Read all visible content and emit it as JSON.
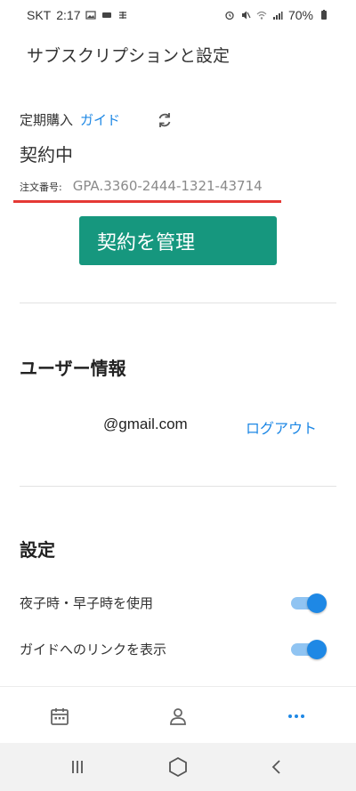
{
  "status_bar": {
    "carrier": "SKT",
    "time": "2:17",
    "battery": "70%"
  },
  "header": {
    "title": "サブスクリプションと設定"
  },
  "subscription": {
    "label": "定期購入",
    "guide_link": "ガイド",
    "status": "契約中",
    "order_label": "注文番号:",
    "order_number": "GPA.3360-2444-1321-43714",
    "manage_button": "契約を管理"
  },
  "user_info": {
    "title": "ユーザー情報",
    "email": "@gmail.com",
    "logout": "ログアウト"
  },
  "settings": {
    "title": "設定",
    "items": [
      {
        "label": "夜子時・早子時を使用",
        "on": true
      },
      {
        "label": "ガイドへのリンクを表示",
        "on": true
      }
    ]
  },
  "colors": {
    "accent": "#1e88e5",
    "button": "#16977e",
    "underline": "#e53935"
  }
}
